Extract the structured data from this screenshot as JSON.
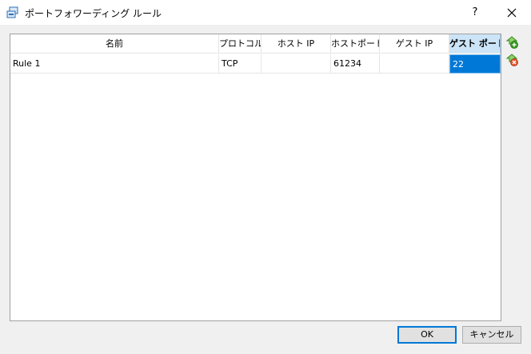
{
  "window": {
    "title": "ポートフォワーディング ルール",
    "help_label": "?"
  },
  "table": {
    "columns": [
      "名前",
      "プロトコル",
      "ホスト IP",
      "ホストポート",
      "ゲスト IP",
      "ゲスト ポート"
    ],
    "rows": [
      {
        "name": "Rule 1",
        "protocol": "TCP",
        "host_ip": "",
        "host_port": "61234",
        "guest_ip": "",
        "guest_port": "22"
      }
    ],
    "sorted_column": "ゲスト ポート",
    "selected_cell": "guest_port"
  },
  "side_buttons": {
    "add_icon": "add-rule-icon",
    "remove_icon": "remove-rule-icon"
  },
  "buttons": {
    "ok": "OK",
    "cancel": "キャンセル"
  },
  "colors": {
    "selection": "#0078d7",
    "active_header": "#cce4f7",
    "add_icon": "#3a9d23",
    "remove_icon": "#d9480f"
  }
}
